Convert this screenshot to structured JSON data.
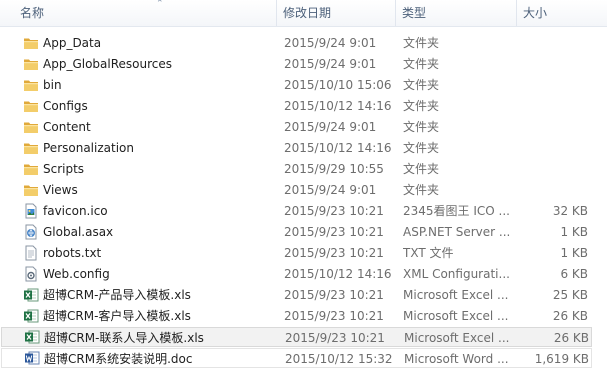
{
  "columns": {
    "name": "名称",
    "date": "修改日期",
    "type": "类型",
    "size": "大小"
  },
  "rows": [
    {
      "name": "App_Data",
      "date": "2015/9/24 9:01",
      "type": "文件夹",
      "size": "",
      "icon": "folder-icon"
    },
    {
      "name": "App_GlobalResources",
      "date": "2015/9/24 9:01",
      "type": "文件夹",
      "size": "",
      "icon": "folder-icon"
    },
    {
      "name": "bin",
      "date": "2015/10/10 15:06",
      "type": "文件夹",
      "size": "",
      "icon": "folder-icon"
    },
    {
      "name": "Configs",
      "date": "2015/10/12 14:16",
      "type": "文件夹",
      "size": "",
      "icon": "folder-icon"
    },
    {
      "name": "Content",
      "date": "2015/9/24 9:01",
      "type": "文件夹",
      "size": "",
      "icon": "folder-icon"
    },
    {
      "name": "Personalization",
      "date": "2015/10/12 14:16",
      "type": "文件夹",
      "size": "",
      "icon": "folder-icon"
    },
    {
      "name": "Scripts",
      "date": "2015/9/29 10:55",
      "type": "文件夹",
      "size": "",
      "icon": "folder-icon"
    },
    {
      "name": "Views",
      "date": "2015/9/24 9:01",
      "type": "文件夹",
      "size": "",
      "icon": "folder-icon"
    },
    {
      "name": "favicon.ico",
      "date": "2015/9/23 10:21",
      "type": "2345看图王 ICO ...",
      "size": "32 KB",
      "icon": "image-file-icon"
    },
    {
      "name": "Global.asax",
      "date": "2015/9/23 10:21",
      "type": "ASP.NET Server ...",
      "size": "1 KB",
      "icon": "aspnet-file-icon"
    },
    {
      "name": "robots.txt",
      "date": "2015/9/23 10:21",
      "type": "TXT 文件",
      "size": "1 KB",
      "icon": "text-file-icon"
    },
    {
      "name": "Web.config",
      "date": "2015/10/12 14:16",
      "type": "XML Configurati...",
      "size": "6 KB",
      "icon": "config-file-icon"
    },
    {
      "name": "超博CRM-产品导入模板.xls",
      "date": "2015/9/23 10:21",
      "type": "Microsoft Excel ...",
      "size": "25 KB",
      "icon": "excel-file-icon"
    },
    {
      "name": "超博CRM-客户导入模板.xls",
      "date": "2015/9/23 10:21",
      "type": "Microsoft Excel ...",
      "size": "26 KB",
      "icon": "excel-file-icon"
    },
    {
      "name": "超博CRM-联系人导入模板.xls",
      "date": "2015/9/23 10:21",
      "type": "Microsoft Excel ...",
      "size": "26 KB",
      "icon": "excel-file-icon",
      "state": "selected"
    },
    {
      "name": "超博CRM系统安装说明.doc",
      "date": "2015/10/12 15:32",
      "type": "Microsoft Word ...",
      "size": "1,619 KB",
      "icon": "word-file-icon",
      "state": "hover"
    }
  ],
  "colors": {
    "header_text": "#4c607a",
    "folder": "#e8b84a",
    "excel": "#1f7244",
    "word": "#2b579a",
    "selected_bg": "#f2f2f2"
  }
}
